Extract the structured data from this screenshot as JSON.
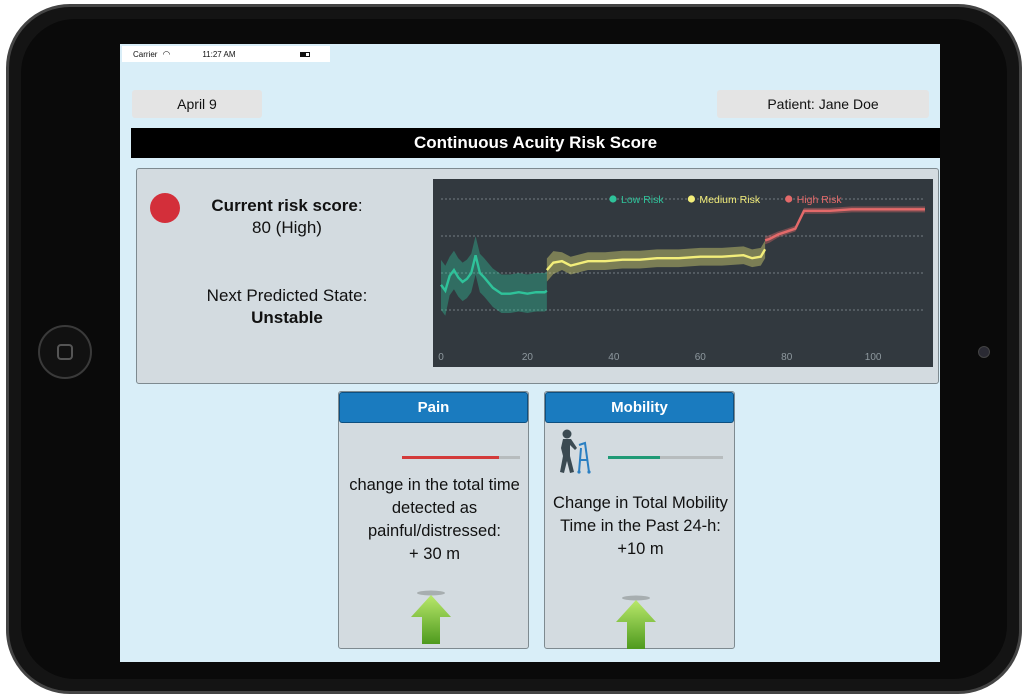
{
  "status_bar": {
    "carrier": "Carrier",
    "time": "11:27 AM"
  },
  "header": {
    "date": "April 9",
    "patient": "Patient: Jane Doe"
  },
  "title": "Continuous Acuity Risk Score",
  "risk": {
    "score_label": "Current risk score",
    "score_sep": ":",
    "score_value": "80 (High)",
    "status_color": "#d32f3a",
    "predict_label": "Next Predicted State:",
    "predict_value": "Unstable"
  },
  "chart_data": {
    "type": "line",
    "x_ticks": [
      0,
      20,
      40,
      60,
      80,
      100
    ],
    "xlim": [
      0,
      112
    ],
    "grid": true,
    "legend_position": "top-right",
    "series": [
      {
        "name": "Low Risk",
        "color": "#2fc29a",
        "x": [
          0,
          1,
          2,
          3,
          4,
          5,
          6,
          7,
          8,
          9,
          10,
          12,
          14,
          16,
          18,
          20,
          22,
          24,
          24.5
        ],
        "y": [
          0.42,
          0.38,
          0.48,
          0.52,
          0.47,
          0.44,
          0.46,
          0.5,
          0.62,
          0.5,
          0.47,
          0.4,
          0.36,
          0.36,
          0.37,
          0.36,
          0.37,
          0.37,
          0.38
        ]
      },
      {
        "name": "Medium Risk",
        "color": "#f3ee7a",
        "x": [
          24.5,
          26,
          28,
          30,
          34,
          38,
          42,
          46,
          50,
          55,
          60,
          65,
          70,
          72,
          74,
          75
        ],
        "y": [
          0.52,
          0.57,
          0.58,
          0.55,
          0.58,
          0.58,
          0.59,
          0.59,
          0.6,
          0.6,
          0.61,
          0.61,
          0.62,
          0.6,
          0.61,
          0.66
        ]
      },
      {
        "name": "High Risk",
        "color": "#e46a6a",
        "x": [
          75,
          76,
          78,
          80,
          82,
          84,
          86,
          88,
          90,
          95,
          100,
          105,
          110,
          112
        ],
        "y": [
          0.72,
          0.73,
          0.76,
          0.78,
          0.8,
          0.92,
          0.92,
          0.92,
          0.92,
          0.93,
          0.93,
          0.93,
          0.93,
          0.93
        ]
      }
    ]
  },
  "pain": {
    "title": "Pain",
    "text": "change in the total time detected as painful/distressed:",
    "value": "+ 30 m",
    "level": 0.82,
    "color": "#d33a3a",
    "trend": "up"
  },
  "mobility": {
    "title": "Mobility",
    "text": "Change in Total Mobility Time in the Past 24-h:",
    "value": "+10 m",
    "level": 0.45,
    "color": "#1f9a76",
    "trend": "up",
    "icon": "walker-icon"
  }
}
